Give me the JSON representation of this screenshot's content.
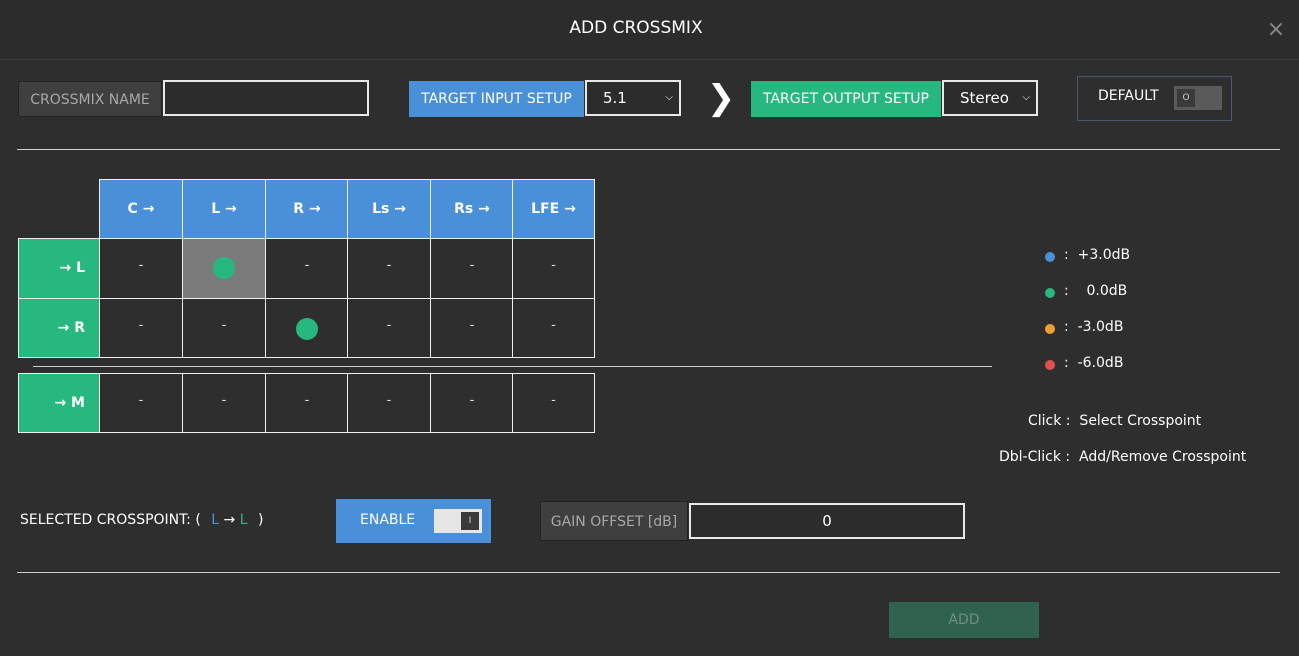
{
  "dialog": {
    "title": "ADD CROSSMIX",
    "close_icon": "×"
  },
  "toolbar": {
    "crossmix_name_label": "CROSSMIX NAME",
    "crossmix_name_value": "",
    "target_input_label": "TARGET INPUT SETUP",
    "target_input_value": "5.1",
    "target_output_label": "TARGET OUTPUT SETUP",
    "target_output_value": "Stereo",
    "arrow": "❯",
    "default_label": "DEFAULT",
    "default_toggle": "O"
  },
  "matrix": {
    "columns": [
      "C →",
      "L →",
      "R →",
      "Ls →",
      "Rs →",
      "LFE →"
    ],
    "rows": [
      {
        "label": "→ L",
        "cells": [
          "-",
          "",
          "-",
          "-",
          "-",
          "-"
        ]
      },
      {
        "label": "→ R",
        "cells": [
          "-",
          "-",
          "",
          "-",
          "-",
          "-"
        ]
      }
    ],
    "mono_row": {
      "label": "→ M",
      "cells": [
        "-",
        "-",
        "-",
        "-",
        "-",
        "-"
      ]
    }
  },
  "legend": [
    {
      "color": "#4a90d9",
      "text": ":  +3.0dB"
    },
    {
      "color": "#27b87f",
      "text": ":    0.0dB"
    },
    {
      "color": "#f0a030",
      "text": ":  -3.0dB"
    },
    {
      "color": "#e05050",
      "text": ":  -6.0dB"
    }
  ],
  "help": {
    "click": "Click :  Select Crosspoint",
    "dblclick": "Dbl-Click :  Add/Remove Crosspoint"
  },
  "selected": {
    "label": "SELECTED CROSSPOINT:  (",
    "from": "L",
    "arrow": "→",
    "to": "L",
    "close": ")",
    "enable_label": "ENABLE",
    "enable_toggle": "I",
    "gain_label": "GAIN OFFSET [dB]",
    "gain_value": "0"
  },
  "footer": {
    "add_label": "ADD"
  }
}
